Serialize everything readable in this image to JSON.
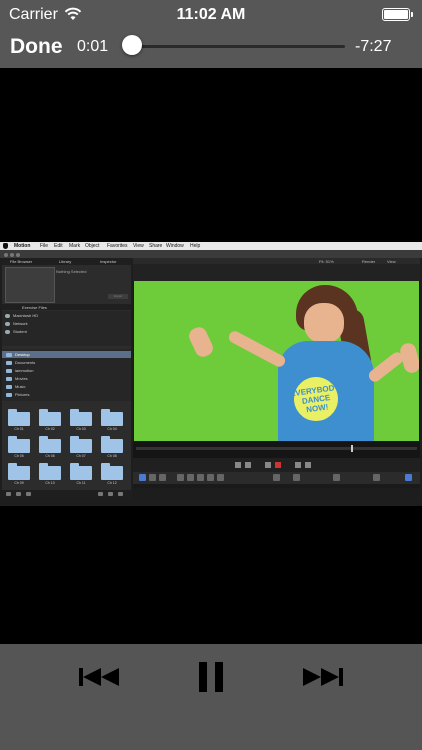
{
  "status_bar": {
    "carrier": "Carrier",
    "time": "11:02 AM",
    "wifi_icon": "wifi-icon",
    "battery_icon": "battery-icon",
    "battery_level": 1.0
  },
  "player": {
    "done_label": "Done",
    "elapsed": "0:01",
    "remaining": "-7:27",
    "progress": 0.002
  },
  "video": {
    "menubar": [
      "Motion",
      "File",
      "Edit",
      "Mark",
      "Object",
      "Favorites",
      "View",
      "Share",
      "Window",
      "Help"
    ],
    "left_tabs": [
      "File Browser",
      "Library",
      "Inspector"
    ],
    "preview_text": "Nothing Selected",
    "import_label": "Import",
    "sources_header": "Exercise Files",
    "sources": [
      "Macintosh HD",
      "Network",
      "Student"
    ],
    "favorites": [
      "Desktop",
      "Documents",
      "iammotion",
      "Movies",
      "Music",
      "Pictures"
    ],
    "folders": [
      "Ch 01",
      "Ch 02",
      "Ch 03",
      "Ch 04",
      "Ch 05",
      "Ch 06",
      "Ch 07",
      "Ch 08",
      "Ch 09",
      "Ch 10",
      "Ch 11",
      "Ch 12"
    ],
    "canvas_top": [
      "Fit: 51%",
      "Render",
      "View"
    ],
    "shirt_text": "EVERYBODY DANCE NOW!",
    "green_screen_color": "#6ecb3a"
  },
  "controls": {
    "previous_icon": "previous-track-icon",
    "pause_icon": "pause-icon",
    "next_icon": "next-track-icon"
  }
}
